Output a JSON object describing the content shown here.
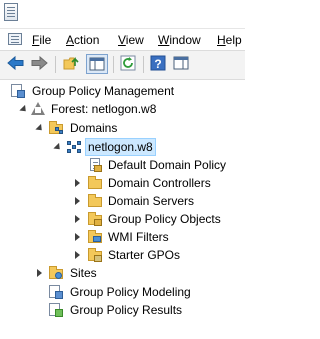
{
  "window": {
    "app_icon": "mmc-console-icon"
  },
  "menubar": {
    "items": [
      {
        "label_u": "F",
        "label_rest": "ile"
      },
      {
        "label_u": "A",
        "label_rest": "ction"
      },
      {
        "label_u": "V",
        "label_rest": "iew"
      },
      {
        "label_u": "W",
        "label_rest": "indow"
      },
      {
        "label_u": "H",
        "label_rest": "elp"
      }
    ]
  },
  "toolbar": {
    "buttons": [
      "back-arrow-icon",
      "forward-arrow-icon",
      "folder-up-icon",
      "console-tree-icon",
      "refresh-icon",
      "help-icon",
      "action-pane-icon"
    ]
  },
  "tree": {
    "root": "Group Policy Management",
    "forest": "Forest: netlogon.w8",
    "domains": "Domains",
    "domain": "netlogon.w8",
    "default_policy": "Default Domain Policy",
    "domain_controllers": "Domain Controllers",
    "domain_servers": "Domain Servers",
    "gpo": "Group Policy Objects",
    "wmi": "WMI Filters",
    "starter": "Starter GPOs",
    "sites": "Sites",
    "modeling": "Group Policy Modeling",
    "results": "Group Policy Results"
  },
  "colors": {
    "selection": "#cce8ff",
    "arrow_blue": "#2a78c8",
    "folder": "#f3c85a"
  }
}
